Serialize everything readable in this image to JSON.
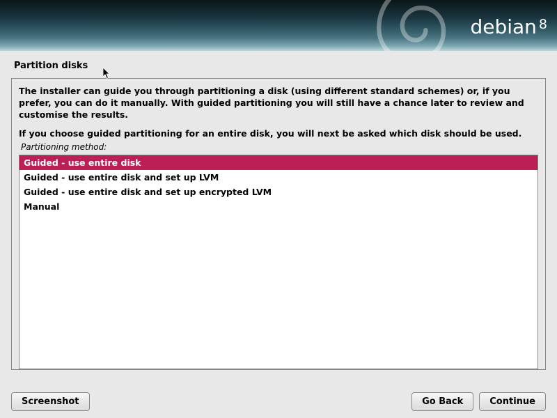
{
  "brand": {
    "name": "debian",
    "version": "8"
  },
  "page": {
    "title": "Partition disks"
  },
  "main": {
    "info1": "The installer can guide you through partitioning a disk (using different standard schemes) or, if you prefer, you can do it manually. With guided partitioning you will still have a chance later to review and customise the results.",
    "info2": "If you choose guided partitioning for an entire disk, you will next be asked which disk should be used.",
    "field_label": "Partitioning method:",
    "options": [
      "Guided - use entire disk",
      "Guided - use entire disk and set up LVM",
      "Guided - use entire disk and set up encrypted LVM",
      "Manual"
    ],
    "selected_index": 0
  },
  "buttons": {
    "screenshot": "Screenshot",
    "goback": "Go Back",
    "continue": "Continue"
  }
}
